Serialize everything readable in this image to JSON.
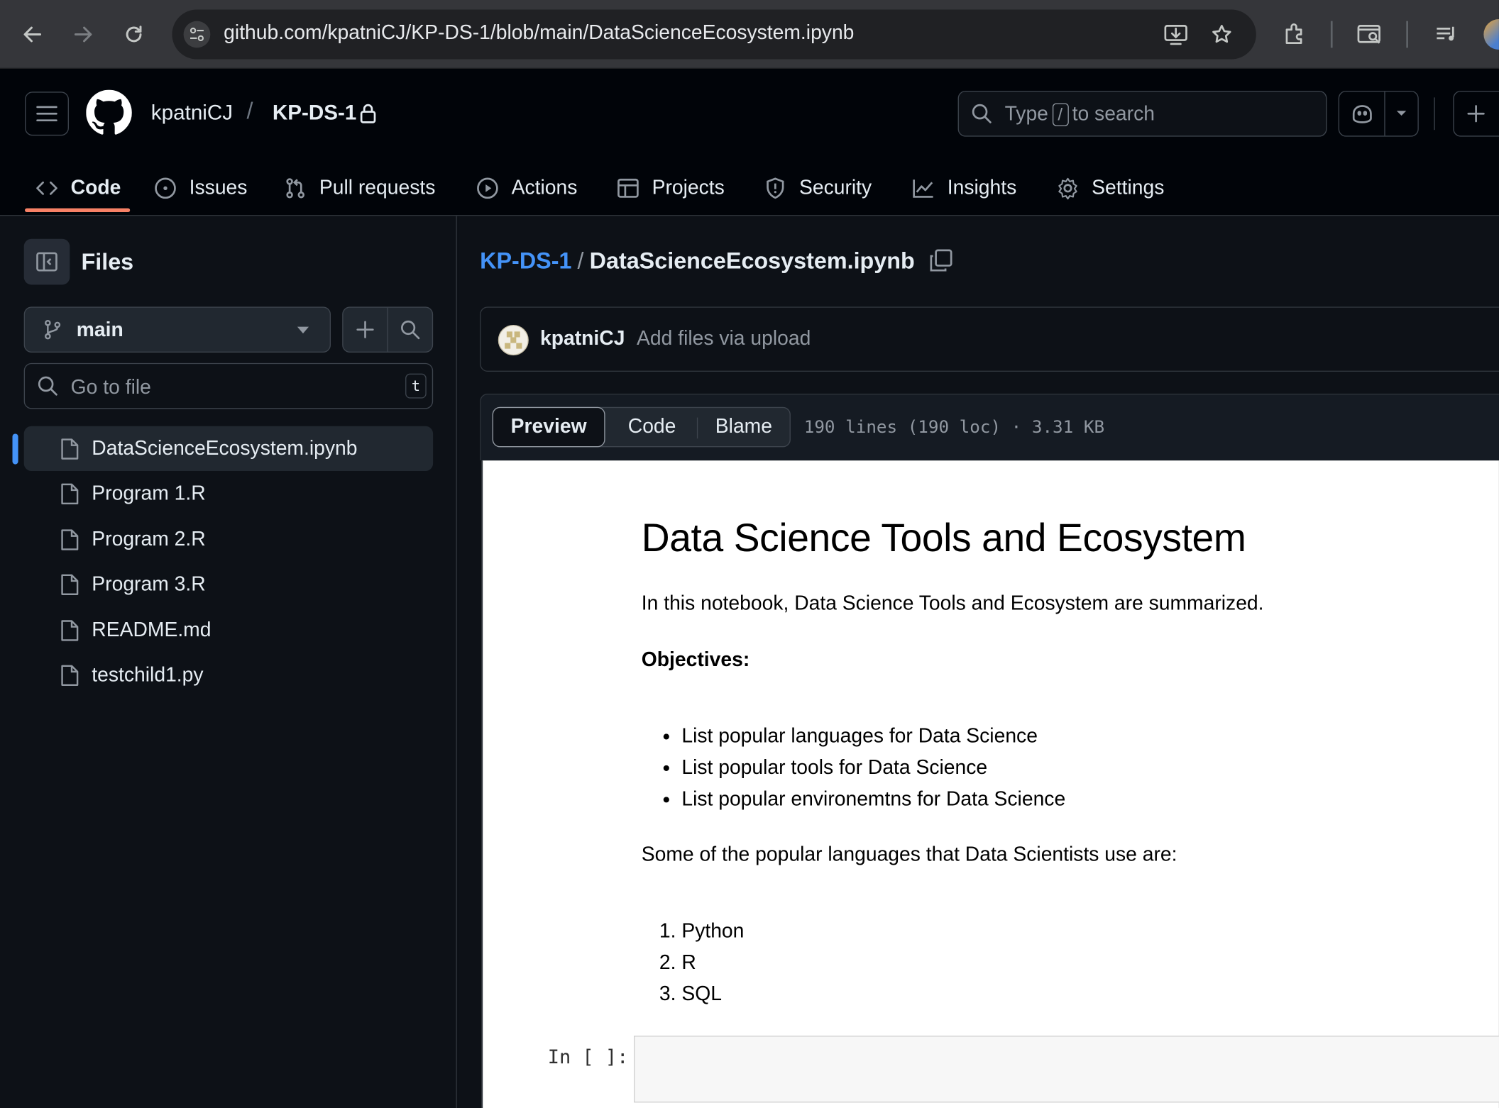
{
  "browser": {
    "url": "github.com/kpatniCJ/KP-DS-1/blob/main/DataScienceEcosystem.ipynb"
  },
  "header": {
    "owner": "kpatniCJ",
    "separator": "/",
    "repo": "KP-DS-1",
    "search": {
      "prefix": "Type",
      "key": "/",
      "suffix": "to search"
    }
  },
  "tabs": [
    {
      "label": "Code",
      "icon": "code-icon",
      "active": true
    },
    {
      "label": "Issues",
      "icon": "issue-icon"
    },
    {
      "label": "Pull requests",
      "icon": "pull-request-icon"
    },
    {
      "label": "Actions",
      "icon": "play-icon"
    },
    {
      "label": "Projects",
      "icon": "table-icon"
    },
    {
      "label": "Security",
      "icon": "shield-icon"
    },
    {
      "label": "Insights",
      "icon": "graph-icon"
    },
    {
      "label": "Settings",
      "icon": "gear-icon"
    }
  ],
  "sidebar": {
    "title": "Files",
    "branch": "main",
    "goto_placeholder": "Go to file",
    "goto_shortcut": "t",
    "files": [
      {
        "name": "DataScienceEcosystem.ipynb",
        "selected": true
      },
      {
        "name": "Program 1.R"
      },
      {
        "name": "Program 2.R"
      },
      {
        "name": "Program 3.R"
      },
      {
        "name": "README.md"
      },
      {
        "name": "testchild1.py"
      }
    ]
  },
  "main": {
    "path_repo": "KP-DS-1",
    "path_sep": "/",
    "path_file": "DataScienceEcosystem.ipynb",
    "commit": {
      "user": "kpatniCJ",
      "message": "Add files via upload"
    },
    "view_tabs": {
      "preview": "Preview",
      "code": "Code",
      "blame": "Blame"
    },
    "file_meta": "190 lines (190 loc) · 3.31 KB"
  },
  "notebook": {
    "title": "Data Science Tools and Ecosystem",
    "intro": "In this notebook, Data Science Tools and Ecosystem are summarized.",
    "objectives_label": "Objectives:",
    "objectives": [
      "List popular languages for Data Science",
      "List popular tools for Data Science",
      "List popular environemtns for Data Science"
    ],
    "languages_intro": "Some of the popular languages that Data Scientists use are:",
    "languages": [
      "Python",
      "R",
      "SQL"
    ],
    "input_prompt": "In [ ]:"
  },
  "colors": {
    "accent_link": "#4493f8",
    "tab_underline": "#f78166",
    "background": "#0d1117"
  }
}
